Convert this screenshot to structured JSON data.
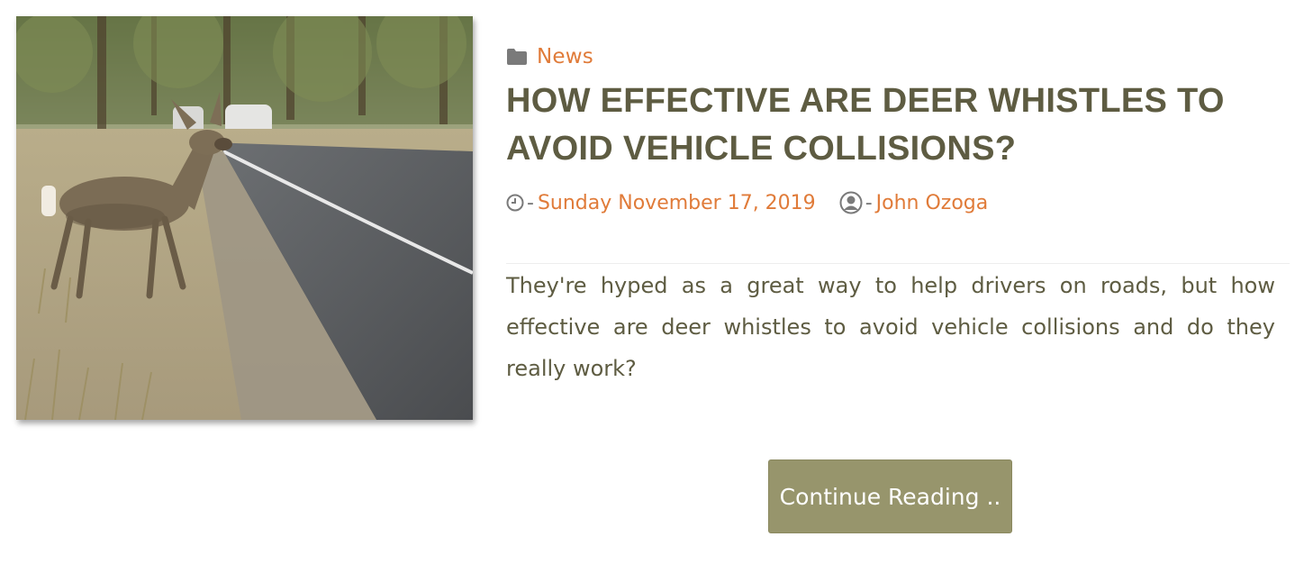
{
  "post": {
    "image_alt": "Deer crossing a road",
    "category": {
      "label": "News",
      "icon": "folder-icon"
    },
    "title": "HOW EFFECTIVE ARE DEER WHISTLES TO AVOID VEHICLE COLLISIONS?",
    "meta": {
      "date_icon": "clock-icon",
      "separator": "-",
      "date": "Sunday November 17, 2019",
      "author_icon": "user-circle-icon",
      "author": "John Ozoga"
    },
    "excerpt": "They're hyped as a great way to help drivers on roads, but how effective are deer whistles to avoid vehicle collisions and do they really work?",
    "continue_label": "Continue Reading .."
  },
  "colors": {
    "accent": "#e07b39",
    "title": "#5e5c42",
    "button_bg": "#97956c",
    "button_text": "#ffffff"
  }
}
